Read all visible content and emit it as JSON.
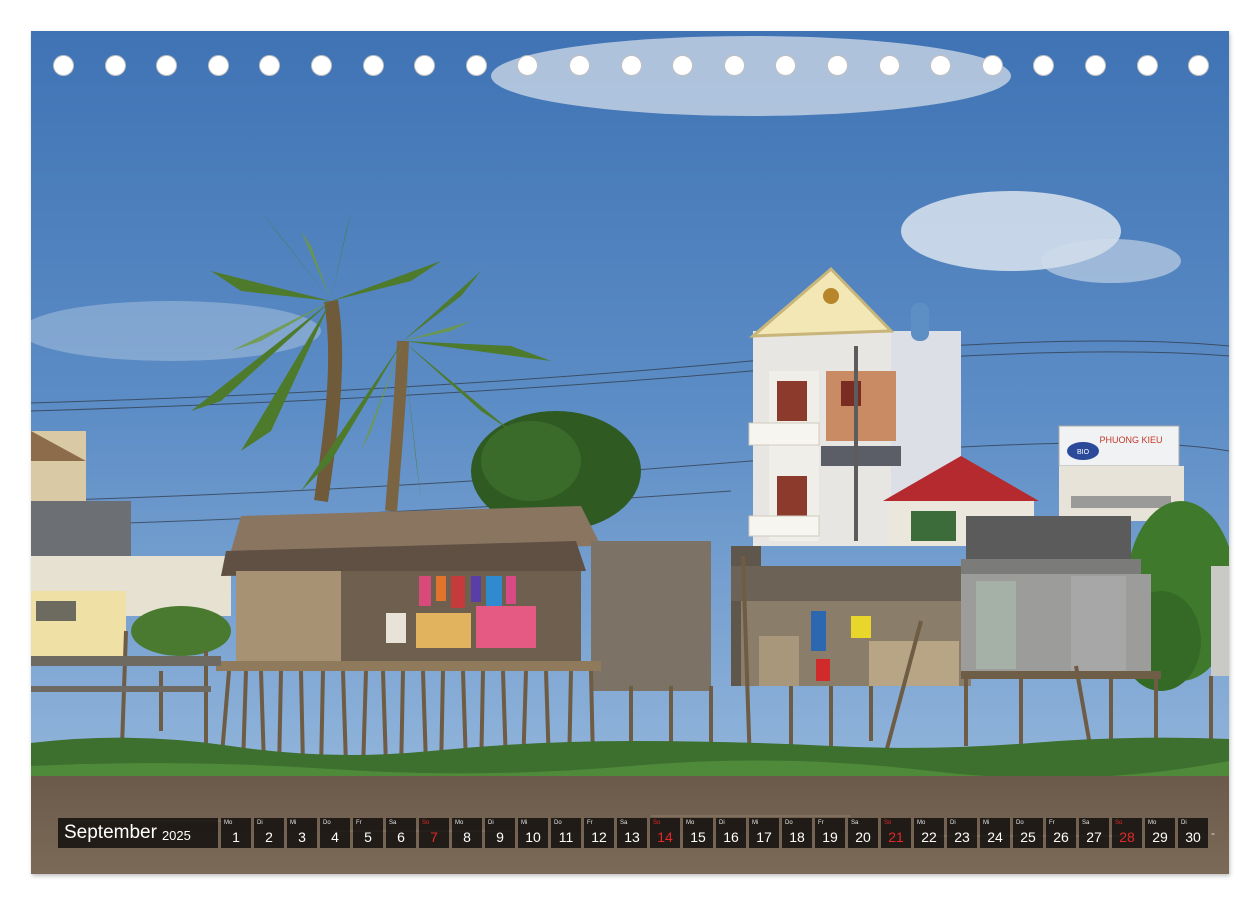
{
  "calendar": {
    "month": "September",
    "year": "2025",
    "days": [
      {
        "wd": "Mo",
        "n": "1",
        "sun": false
      },
      {
        "wd": "Di",
        "n": "2",
        "sun": false
      },
      {
        "wd": "Mi",
        "n": "3",
        "sun": false
      },
      {
        "wd": "Do",
        "n": "4",
        "sun": false
      },
      {
        "wd": "Fr",
        "n": "5",
        "sun": false
      },
      {
        "wd": "Sa",
        "n": "6",
        "sun": false
      },
      {
        "wd": "So",
        "n": "7",
        "sun": true
      },
      {
        "wd": "Mo",
        "n": "8",
        "sun": false
      },
      {
        "wd": "Di",
        "n": "9",
        "sun": false
      },
      {
        "wd": "Mi",
        "n": "10",
        "sun": false
      },
      {
        "wd": "Do",
        "n": "11",
        "sun": false
      },
      {
        "wd": "Fr",
        "n": "12",
        "sun": false
      },
      {
        "wd": "Sa",
        "n": "13",
        "sun": false
      },
      {
        "wd": "So",
        "n": "14",
        "sun": true
      },
      {
        "wd": "Mo",
        "n": "15",
        "sun": false
      },
      {
        "wd": "Di",
        "n": "16",
        "sun": false
      },
      {
        "wd": "Mi",
        "n": "17",
        "sun": false
      },
      {
        "wd": "Do",
        "n": "18",
        "sun": false
      },
      {
        "wd": "Fr",
        "n": "19",
        "sun": false
      },
      {
        "wd": "Sa",
        "n": "20",
        "sun": false
      },
      {
        "wd": "So",
        "n": "21",
        "sun": true
      },
      {
        "wd": "Mo",
        "n": "22",
        "sun": false
      },
      {
        "wd": "Di",
        "n": "23",
        "sun": false
      },
      {
        "wd": "Mi",
        "n": "24",
        "sun": false
      },
      {
        "wd": "Do",
        "n": "25",
        "sun": false
      },
      {
        "wd": "Fr",
        "n": "26",
        "sun": false
      },
      {
        "wd": "Sa",
        "n": "27",
        "sun": false
      },
      {
        "wd": "So",
        "n": "28",
        "sun": true
      },
      {
        "wd": "Mo",
        "n": "29",
        "sun": false
      },
      {
        "wd": "Di",
        "n": "30",
        "sun": false
      }
    ],
    "trailing": "-"
  },
  "photo": {
    "sign_text": "PHUONG KIEU",
    "sign_logo": "BIO"
  },
  "colors": {
    "sunday": "#e2282a",
    "bar": "rgba(0,0,0,0.72)"
  }
}
